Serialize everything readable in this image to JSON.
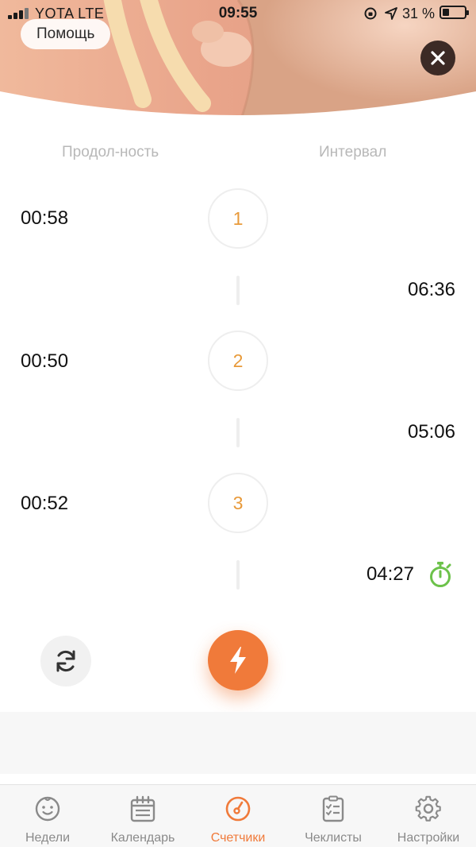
{
  "status_bar": {
    "carrier": "YOTA  LTE",
    "time": "09:55",
    "battery_percent": "31 %",
    "battery_level": 0.31
  },
  "header": {
    "help_label": "Помощь",
    "close_icon": "close-icon"
  },
  "columns": {
    "duration": "Продол-ность",
    "interval": "Интервал"
  },
  "contractions": [
    {
      "number": "1",
      "duration": "00:58"
    },
    {
      "number": "2",
      "duration": "00:50"
    },
    {
      "number": "3",
      "duration": "00:52"
    }
  ],
  "intervals": [
    "06:36",
    "05:06"
  ],
  "live_interval": "04:27",
  "controls": {
    "reset_icon": "refresh-icon",
    "contraction_icon": "lightning-icon"
  },
  "tabs": [
    {
      "label": "Недели",
      "icon": "baby-face-icon",
      "active": false
    },
    {
      "label": "Календарь",
      "icon": "calendar-icon",
      "active": false
    },
    {
      "label": "Счетчики",
      "icon": "counter-gauge-icon",
      "active": true
    },
    {
      "label": "Чеклисты",
      "icon": "checklist-icon",
      "active": false
    },
    {
      "label": "Настройки",
      "icon": "gear-icon",
      "active": false
    }
  ],
  "colors": {
    "accent": "#f07a3a",
    "number": "#e89a3a",
    "stopwatch": "#6cc24a",
    "hero_bg": "#e7a98d"
  }
}
